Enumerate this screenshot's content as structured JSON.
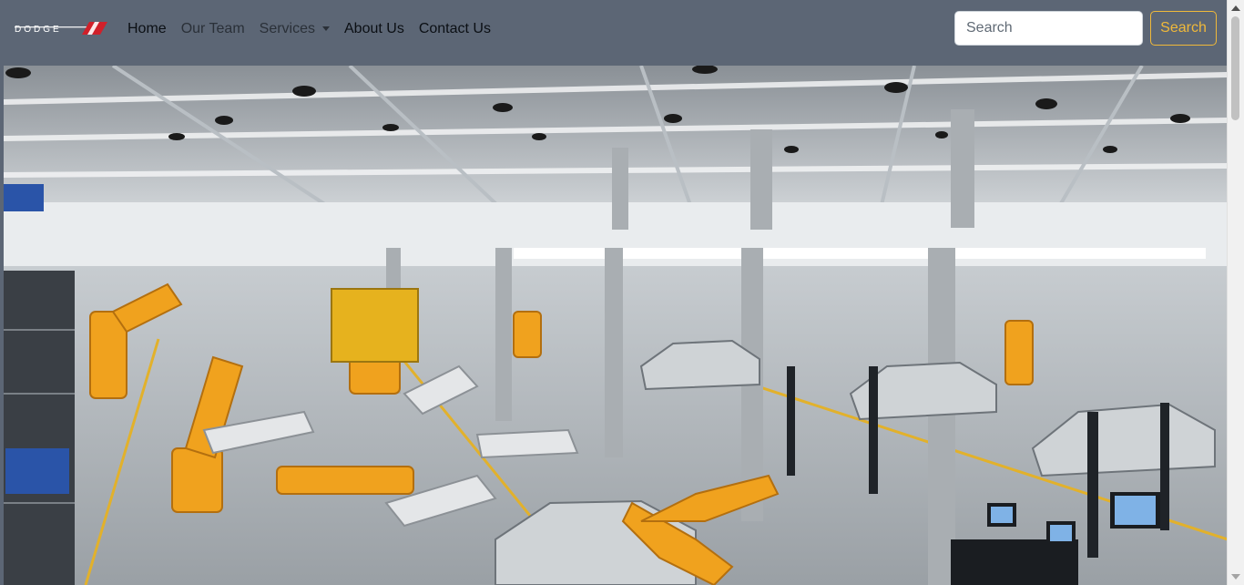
{
  "navbar": {
    "brand": "DODGE",
    "links": [
      {
        "label": "Home"
      },
      {
        "label": "Our Team"
      },
      {
        "label": "Services"
      },
      {
        "label": "About Us"
      },
      {
        "label": "Contact Us"
      }
    ],
    "search": {
      "placeholder": "Search",
      "button_label": "Search"
    }
  },
  "colors": {
    "navbar_bg": "#5c6675",
    "accent": "#f0b93a",
    "brand_red": "#d0202a",
    "robot_orange": "#f0a21e"
  },
  "hero": {
    "image_alt": "Automated car assembly line with orange and white robotic arms in a factory"
  }
}
